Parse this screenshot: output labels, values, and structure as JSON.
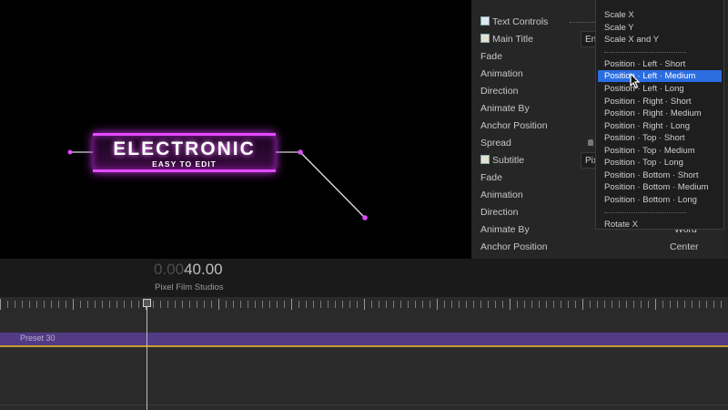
{
  "viewer": {
    "title_main": "ELECTRONIC",
    "title_sub": "EASY TO  EDIT"
  },
  "inspector": {
    "rows": [
      {
        "label": "Text Controls",
        "checkbox": true
      },
      {
        "label": "Main Title",
        "checkbox": true
      },
      {
        "label": "Fade"
      },
      {
        "label": "Animation"
      },
      {
        "label": "Direction"
      },
      {
        "label": "Animate By"
      },
      {
        "label": "Anchor Position"
      },
      {
        "label": "Spread"
      },
      {
        "label": "Subtitle",
        "checkbox": true
      },
      {
        "label": "Fade"
      },
      {
        "label": "Animation"
      },
      {
        "label": "Direction"
      },
      {
        "label": "Animate By"
      },
      {
        "label": "Anchor Position"
      }
    ],
    "main_title_value": "En",
    "subtitle_value": "Pix",
    "animate_by_value": "Word",
    "anchor_position_value": "Center"
  },
  "menu": {
    "items": [
      "Scale X",
      "Scale Y",
      "Scale X and Y",
      "Position · Left · Short",
      "Position · Left · Medium",
      "Position · Left · Long",
      "Position · Right · Short",
      "Position · Right · Medium",
      "Position · Right · Long",
      "Position · Top · Short",
      "Position · Top · Medium",
      "Position · Top · Long",
      "Position · Bottom · Short",
      "Position · Bottom · Medium",
      "Position · Bottom · Long",
      "Rotate X"
    ],
    "selected": "Position · Left · Medium"
  },
  "timeline": {
    "timecode_dim": "0.00",
    "timecode_lit": "40.00",
    "project_name": "Pixel Film Studios",
    "clip_label": "Preset 30"
  },
  "colors": {
    "accent_magenta": "#e24cff",
    "menu_selection": "#2b6de0",
    "clip_purple": "#523a85",
    "clip_gold": "#c89b2c"
  }
}
